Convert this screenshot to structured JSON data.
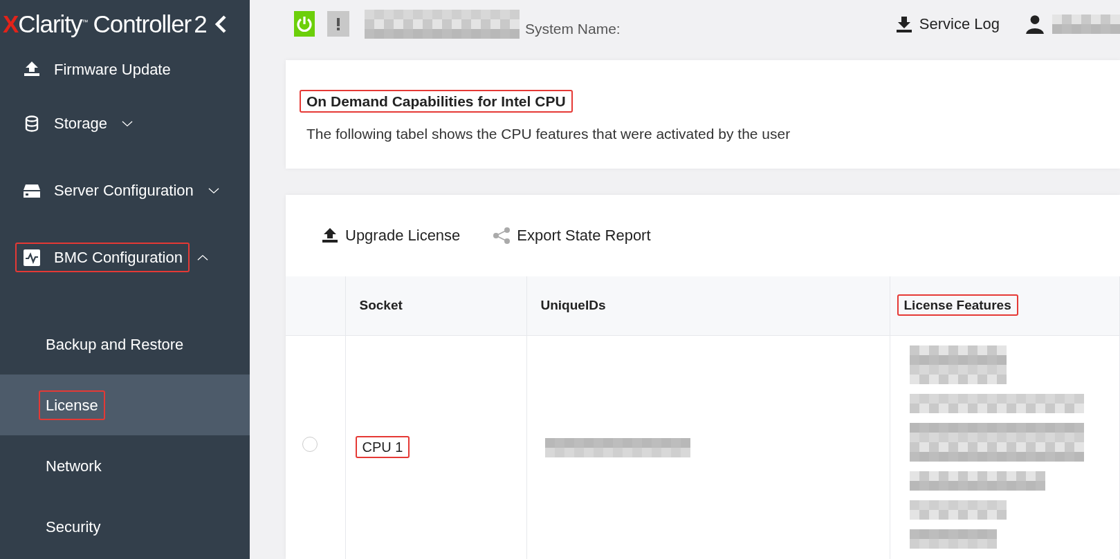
{
  "logo": {
    "mark": "X",
    "name": "Clarity",
    "trademark": "™",
    "product": "Controller",
    "version": "2"
  },
  "sidebar": {
    "items": [
      {
        "label": "Firmware Update",
        "highlighted": false
      },
      {
        "label": "Storage",
        "expanded": false,
        "highlighted": false
      },
      {
        "label": "Server Configuration",
        "expanded": false,
        "highlighted": false
      },
      {
        "label": "BMC Configuration",
        "expanded": true,
        "highlighted": true,
        "children": [
          {
            "label": "Backup and Restore",
            "selected": false,
            "highlighted": false
          },
          {
            "label": "License",
            "selected": true,
            "highlighted": true
          },
          {
            "label": "Network",
            "selected": false,
            "highlighted": false
          },
          {
            "label": "Security",
            "selected": false,
            "highlighted": false
          }
        ]
      }
    ]
  },
  "top_bar": {
    "power_on": true,
    "system_label": "System Name:",
    "service_log": "Service Log"
  },
  "info_card": {
    "title": "On Demand Capabilities for Intel CPU",
    "title_highlighted": true,
    "description": "The following tabel shows the CPU features that were activated by the user"
  },
  "toolbar": [
    {
      "label": "Upgrade License"
    },
    {
      "label": "Export State Report"
    }
  ],
  "table": {
    "columns": [
      {
        "label": "Socket",
        "highlighted": false
      },
      {
        "label": "UniqueIDs",
        "highlighted": false
      },
      {
        "label": "License Features",
        "highlighted": true
      }
    ],
    "rows": [
      {
        "selected": false,
        "socket": "CPU 1",
        "socket_highlighted": true
      }
    ]
  }
}
